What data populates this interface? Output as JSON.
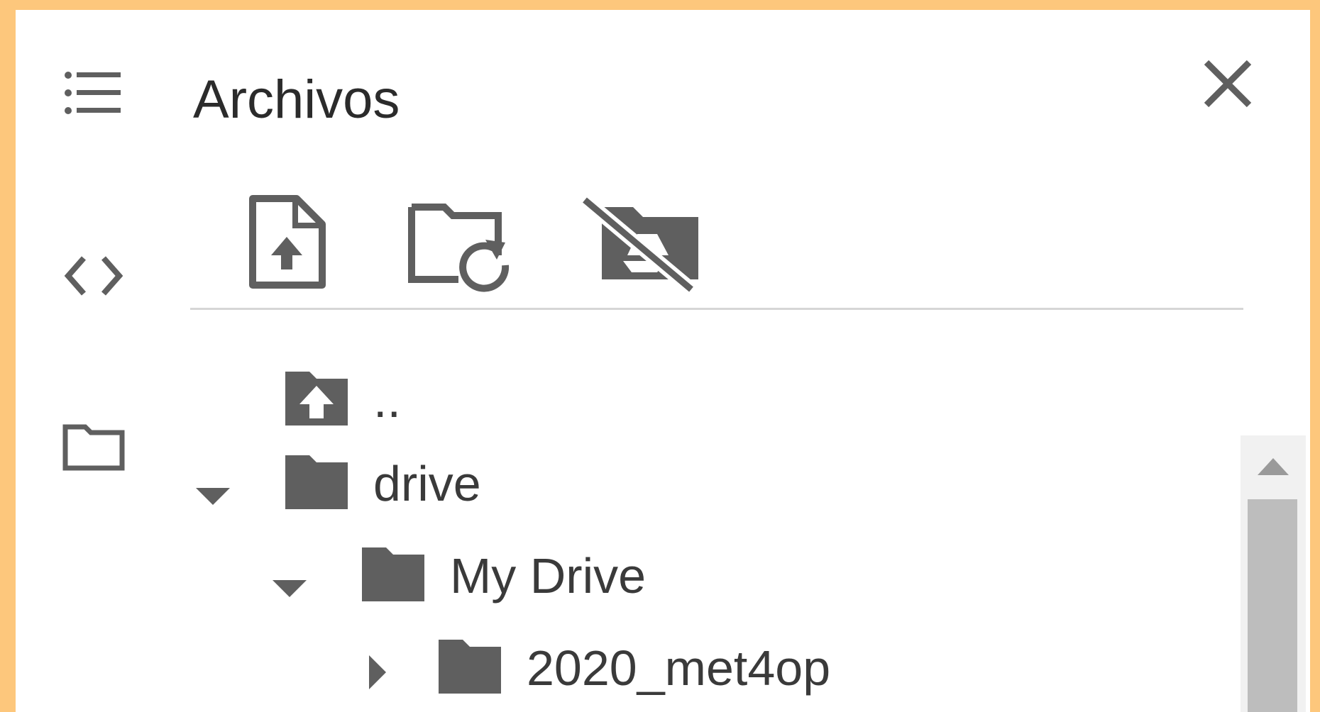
{
  "panel": {
    "title": "Archivos"
  },
  "rail": {
    "items": [
      "menu-icon",
      "code-icon",
      "folder-icon"
    ]
  },
  "toolbar": {
    "buttons": [
      "upload-file-icon",
      "refresh-folder-icon",
      "drive-disabled-icon"
    ]
  },
  "tree": {
    "items": [
      {
        "label": "..",
        "icon": "folder-up-icon",
        "expanded": null,
        "depth": 0
      },
      {
        "label": "drive",
        "icon": "folder-icon",
        "expanded": true,
        "depth": 0
      },
      {
        "label": "My Drive",
        "icon": "folder-icon",
        "expanded": true,
        "depth": 1
      },
      {
        "label": "2020_met4op",
        "icon": "folder-icon",
        "expanded": false,
        "depth": 2
      }
    ]
  },
  "colors": {
    "frame": "#FDC77C",
    "panel_bg": "#FFFFFF",
    "icon": "#5F5F5F",
    "text": "#3A3A3A",
    "divider": "#D6D6D6",
    "scroll_track": "#F1F1F1",
    "scroll_thumb": "#BDBDBD"
  }
}
